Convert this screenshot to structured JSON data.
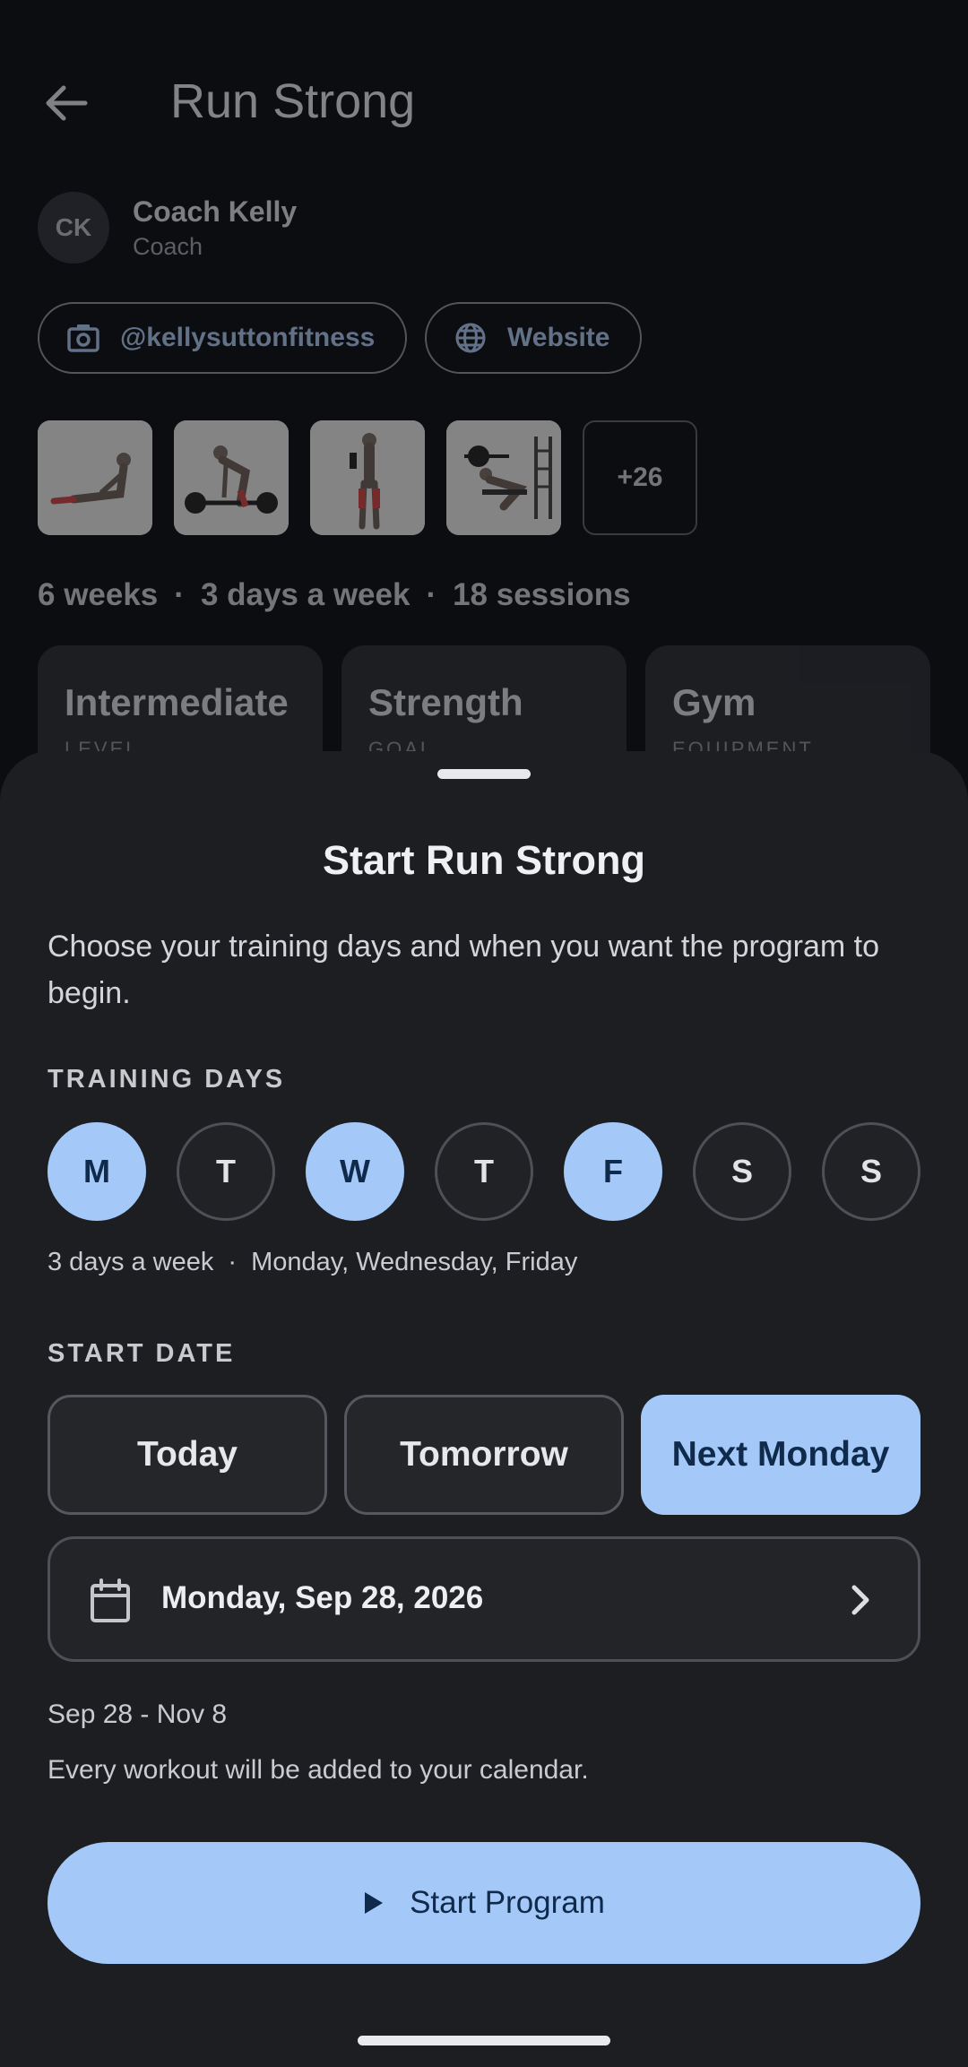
{
  "header": {
    "title": "Run Strong"
  },
  "coach": {
    "initials": "CK",
    "name": "Coach Kelly",
    "role": "Coach"
  },
  "links": {
    "instagram": "@kellysuttonfitness",
    "website": "Website"
  },
  "thumbnails": {
    "more": "+26"
  },
  "program_meta": {
    "weeks": "6 weeks",
    "frequency": "3 days a week",
    "sessions": "18 sessions"
  },
  "stats": [
    {
      "value": "Intermediate",
      "label": "LEVEL"
    },
    {
      "value": "Strength",
      "label": "GOAL"
    },
    {
      "value": "Gym",
      "label": "EQUIPMENT"
    }
  ],
  "sheet": {
    "title": "Start Run Strong",
    "description": "Choose your training days and when you want the program to begin.",
    "training_days_label": "TRAINING DAYS",
    "days": [
      {
        "letter": "M",
        "selected": true
      },
      {
        "letter": "T",
        "selected": false
      },
      {
        "letter": "W",
        "selected": true
      },
      {
        "letter": "T",
        "selected": false
      },
      {
        "letter": "F",
        "selected": true
      },
      {
        "letter": "S",
        "selected": false
      },
      {
        "letter": "S",
        "selected": false
      }
    ],
    "days_count": "3 days a week",
    "days_names": "Monday, Wednesday, Friday",
    "start_date_label": "START DATE",
    "date_options": [
      {
        "label": "Today",
        "selected": false
      },
      {
        "label": "Tomorrow",
        "selected": false
      },
      {
        "label": "Next Monday",
        "selected": true
      }
    ],
    "selected_date": "Monday, Sep 28, 2026",
    "range": "Sep 28 - Nov 8",
    "note": "Every workout will be added to your calendar.",
    "start_button": "Start Program"
  },
  "colors": {
    "accent": "#a4c9f8",
    "accent_text": "#0f2a4a",
    "sheet_bg": "#1d1e22"
  }
}
